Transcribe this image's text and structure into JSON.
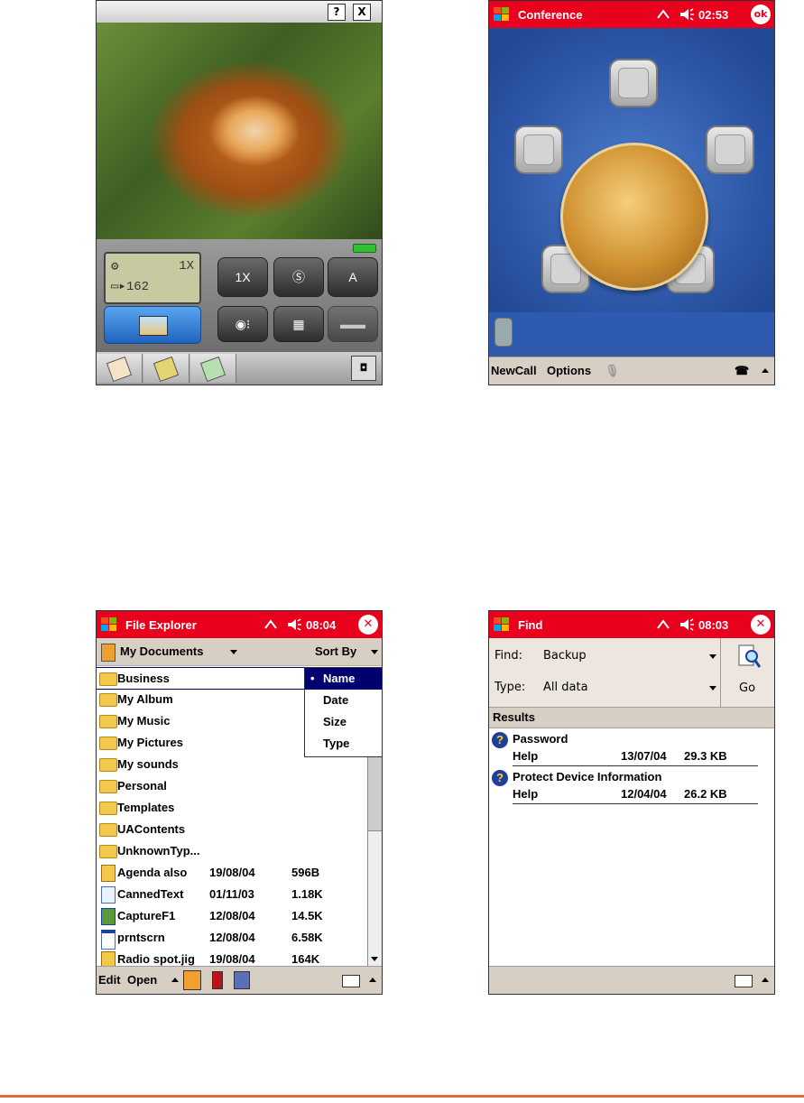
{
  "camera": {
    "help_btn": "?",
    "close_btn": "X",
    "lcd_zoom": "1X",
    "lcd_count": "162",
    "btn_zoom": "1X",
    "btn_auto": "A",
    "btn_mode": "",
    "btn_sz": "",
    "tab_icons": [
      "notes-icon",
      "pencil-icon",
      "calculator-icon"
    ],
    "colors": {
      "shoot_button": "#1f64c0",
      "battery": "#30c030"
    }
  },
  "conference": {
    "title": "Conference",
    "time": "02:53",
    "ok": "ok",
    "menu_newcall": "NewCall",
    "menu_options": "Options"
  },
  "explorer": {
    "title": "File Explorer",
    "time": "08:04",
    "path": "My Documents",
    "sort": "Sort By",
    "sort_options": [
      "Name",
      "Date",
      "Size",
      "Type"
    ],
    "rows": [
      {
        "type": "folder",
        "name": "Business",
        "date": "",
        "size": ""
      },
      {
        "type": "folder",
        "name": "My Album",
        "date": "",
        "size": ""
      },
      {
        "type": "folder",
        "name": "My Music",
        "date": "",
        "size": ""
      },
      {
        "type": "folder",
        "name": "My Pictures",
        "date": "",
        "size": ""
      },
      {
        "type": "folder",
        "name": "My sounds",
        "date": "",
        "size": ""
      },
      {
        "type": "folder",
        "name": "Personal",
        "date": "",
        "size": ""
      },
      {
        "type": "folder",
        "name": "Templates",
        "date": "",
        "size": ""
      },
      {
        "type": "folder",
        "name": "UAContents",
        "date": "",
        "size": ""
      },
      {
        "type": "folder",
        "name": "UnknownTyp...",
        "date": "",
        "size": ""
      },
      {
        "type": "file",
        "name": "Agenda also",
        "date": "19/08/04",
        "size": "596B"
      },
      {
        "type": "file",
        "name": "CannedText",
        "date": "01/11/03",
        "size": "1.18K"
      },
      {
        "type": "file",
        "name": "CaptureF1",
        "date": "12/08/04",
        "size": "14.5K"
      },
      {
        "type": "file",
        "name": "prntscrn",
        "date": "12/08/04",
        "size": "6.58K"
      },
      {
        "type": "file",
        "name": "Radio spot.jig",
        "date": "19/08/04",
        "size": "164K"
      }
    ],
    "menu_edit": "Edit",
    "menu_open": "Open"
  },
  "find": {
    "title": "Find",
    "time": "08:03",
    "find_label": "Find:",
    "find_value": "Backup",
    "type_label": "Type:",
    "type_value": "All data",
    "go": "Go",
    "results_header": "Results",
    "results": [
      {
        "title": "Password",
        "source": "Help",
        "date": "13/07/04",
        "size": "29.3 KB"
      },
      {
        "title": "Protect Device Information",
        "source": "Help",
        "date": "12/04/04",
        "size": "26.2 KB"
      }
    ]
  },
  "colors": {
    "title_bar": "#e8001d",
    "menu_bar": "#d8cfc4",
    "footer_rule": "#e66a40"
  }
}
